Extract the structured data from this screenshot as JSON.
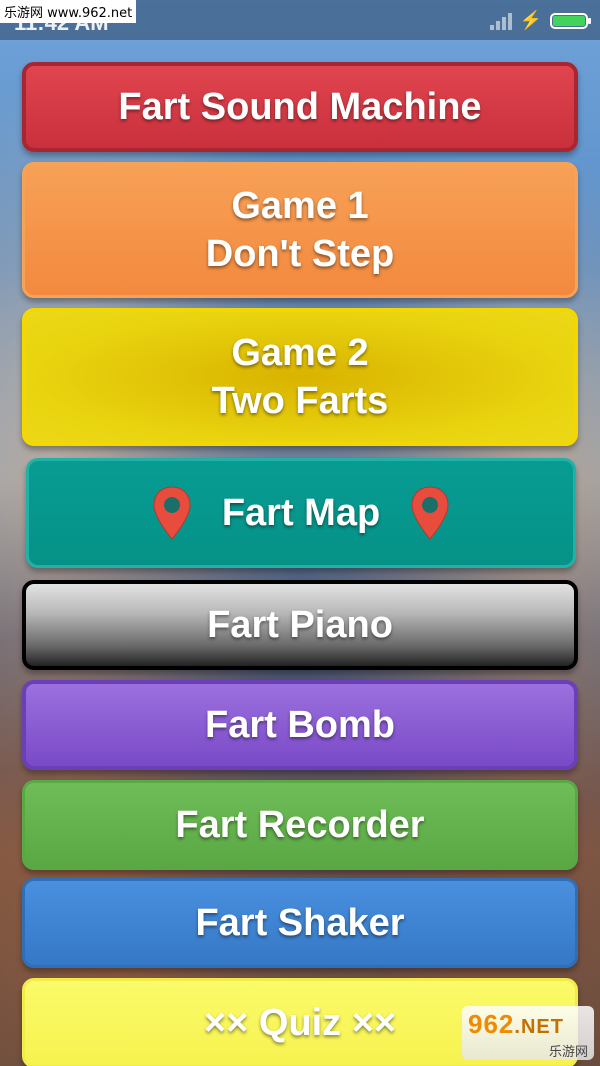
{
  "status_bar": {
    "watermark": "乐游网 www.962.net",
    "time": "11:42 AM",
    "battery_color": "#42d35b"
  },
  "menu": {
    "fart_sound_machine": "Fart Sound Machine",
    "game1_line1": "Game 1",
    "game1_line2": "Don't Step",
    "game2_line1": "Game 2",
    "game2_line2": "Two Farts",
    "fart_map": "Fart Map",
    "fart_piano": "Fart Piano",
    "fart_bomb": "Fart Bomb",
    "fart_recorder": "Fart Recorder",
    "fart_shaker": "Fart Shaker",
    "quiz": "×× Quiz ××"
  },
  "icons": {
    "map_pin": "map-pin-icon",
    "pin_color": "#e84c3d"
  },
  "watermark_bottom": {
    "big": "962",
    "net": ".NET",
    "small": "乐游网"
  }
}
